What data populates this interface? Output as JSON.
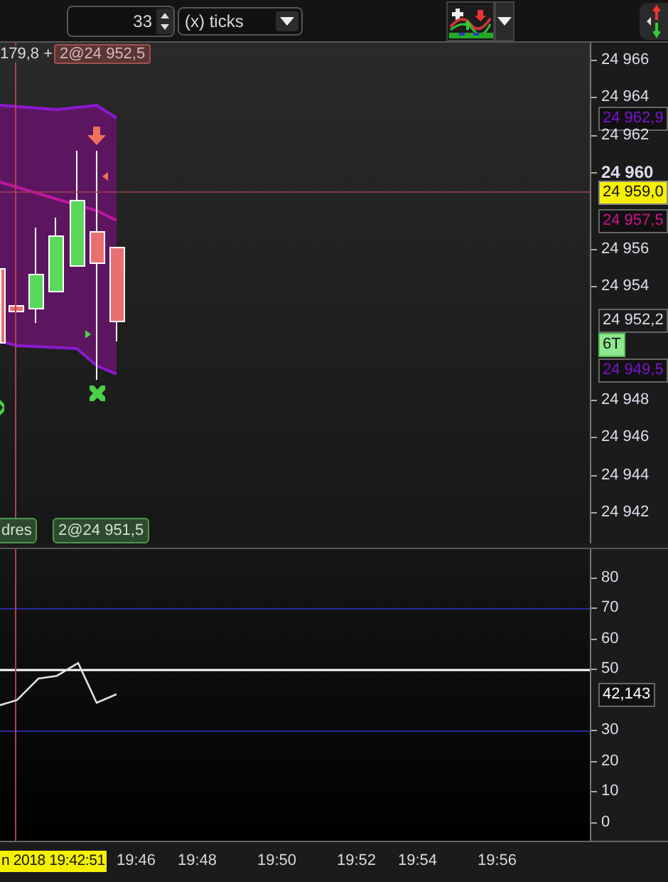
{
  "toolbar": {
    "period_value": "33",
    "period_unit": "(x) ticks"
  },
  "price_panel": {
    "header_text": "179,8 +",
    "header_order": "2@24 952,5",
    "axis_labels": [
      {
        "text": "24 966",
        "kind": "tick"
      },
      {
        "text": "24 964",
        "kind": "tick"
      },
      {
        "text": "24 962,9",
        "kind": "marker",
        "color": "#7a14d0"
      },
      {
        "text": "24 962",
        "kind": "tick"
      },
      {
        "text": "24 960",
        "kind": "major"
      },
      {
        "text": "24 959,0",
        "kind": "cursor"
      },
      {
        "text": "24 957,5",
        "kind": "marker",
        "color": "#d0148c"
      },
      {
        "text": "24 956",
        "kind": "tick"
      },
      {
        "text": "24 954",
        "kind": "tick"
      },
      {
        "text": "24 952,2",
        "kind": "last"
      },
      {
        "text": "6T",
        "kind": "count"
      },
      {
        "text": "24 949,5",
        "kind": "marker",
        "color": "#7a14d0"
      },
      {
        "text": "24 948",
        "kind": "tick"
      },
      {
        "text": "24 946",
        "kind": "tick"
      },
      {
        "text": "24 944",
        "kind": "tick"
      },
      {
        "text": "24 942",
        "kind": "tick"
      }
    ],
    "bottom_tags": [
      "dres",
      "2@24 951,5"
    ]
  },
  "oscillator": {
    "value_label": "42,143",
    "axis_labels": [
      "80",
      "70",
      "60",
      "50",
      "30",
      "20",
      "10",
      "0"
    ]
  },
  "time_axis": {
    "cursor_label": "n 2018 19:42:51",
    "labels": [
      "19:46",
      "19:48",
      "19:50",
      "19:52",
      "19:54",
      "19:56"
    ]
  }
}
